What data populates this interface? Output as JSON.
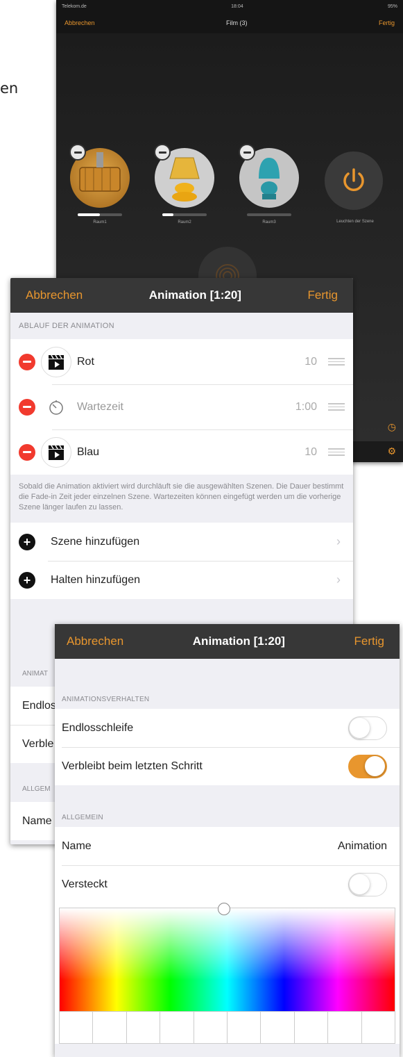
{
  "left_edge_text": "en",
  "screen1": {
    "status_carrier": "Telekom.de",
    "status_time": "18:04",
    "status_battery": "95%",
    "nav": {
      "cancel": "Abbrechen",
      "title": "Film (3)",
      "done": "Fertig"
    },
    "lamps": [
      {
        "label": "Raum1",
        "brightness": 0.5,
        "color": "#c9862a"
      },
      {
        "label": "Raum2",
        "brightness": 0.25,
        "color": "#e6b53b"
      },
      {
        "label": "Raum3",
        "brightness": 0,
        "color": "#2ea2b0"
      }
    ],
    "power_label": "Leuchten der Szene",
    "accent": "#e8962e"
  },
  "screen2": {
    "nav": {
      "cancel": "Abbrechen",
      "title": "Animation [1:20]",
      "done": "Fertig"
    },
    "section_header": "ABLAUF DER ANIMATION",
    "steps": [
      {
        "label": "Rot",
        "value": "10",
        "icon": "scene-clapper-icon",
        "grey": false
      },
      {
        "label": "Wartezeit",
        "value": "1:00",
        "icon": "timer-icon",
        "grey": true
      },
      {
        "label": "Blau",
        "value": "10",
        "icon": "scene-clapper-icon",
        "grey": false
      }
    ],
    "footer": "Sobald die Animation aktiviert wird durchläuft sie die ausgewählten Szenen. Die Dauer bestimmt die Fade-in Zeit jeder einzelnen Szene. Wartezeiten können eingefügt werden um die vorherige Szene länger laufen zu lassen.",
    "add_scene": "Szene hinzufügen",
    "add_hold": "Halten hinzufügen",
    "under_header_1": "ANIMAT",
    "under_cell_1": "Endlos",
    "under_cell_2": "Verble",
    "under_header_2": "ALLGEM",
    "under_cell_3": "Name"
  },
  "screen3": {
    "nav": {
      "cancel": "Abbrechen",
      "title": "Animation [1:20]",
      "done": "Fertig"
    },
    "behavior_header": "ANIMATIONSVERHALTEN",
    "loop_label": "Endlosschleife",
    "loop_on": false,
    "stay_label": "Verbleibt beim letzten Schritt",
    "stay_on": true,
    "general_header": "ALLGEMEIN",
    "name_label": "Name",
    "name_value": "Animation",
    "hidden_label": "Versteckt",
    "hidden_on": false
  }
}
